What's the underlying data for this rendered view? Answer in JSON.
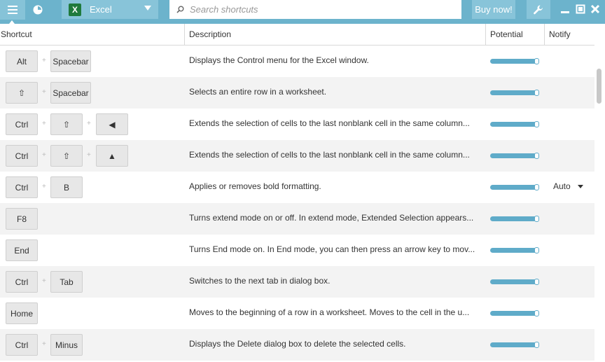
{
  "topbar": {
    "menu_icon": "hamburger-icon",
    "history_icon": "clock-icon",
    "app_selector": {
      "label": "Excel",
      "icon": "excel-icon"
    },
    "search": {
      "placeholder": "Search shortcuts",
      "value": ""
    },
    "buy_label": "Buy now!",
    "tools_icon": "wrench-icon",
    "window_controls": [
      "minimize-icon",
      "maximize-icon",
      "close-icon"
    ]
  },
  "table": {
    "columns": [
      "Shortcut",
      "Description",
      "Potential",
      "Notify"
    ],
    "rows": [
      {
        "keys": [
          "Alt",
          "Spacebar"
        ],
        "description": "Displays the Control menu for the Excel window.",
        "notify": ""
      },
      {
        "keys": [
          "⇧",
          "Spacebar"
        ],
        "description": "Selects an entire row in a worksheet.",
        "notify": ""
      },
      {
        "keys": [
          "Ctrl",
          "⇧",
          "◀"
        ],
        "description": "Extends the selection of cells to the last nonblank cell in the same column...",
        "notify": ""
      },
      {
        "keys": [
          "Ctrl",
          "⇧",
          "▲"
        ],
        "description": "Extends the selection of cells to the last nonblank cell in the same column...",
        "notify": ""
      },
      {
        "keys": [
          "Ctrl",
          "B"
        ],
        "description": "Applies or removes bold formatting.",
        "notify": "Auto"
      },
      {
        "keys": [
          "F8"
        ],
        "description": "Turns extend mode on or off. In extend mode, Extended Selection appears...",
        "notify": ""
      },
      {
        "keys": [
          "End"
        ],
        "description": "Turns End mode on. In End mode, you can then press an arrow key to mov...",
        "notify": ""
      },
      {
        "keys": [
          "Ctrl",
          "Tab"
        ],
        "description": "Switches to the next tab in dialog box.",
        "notify": ""
      },
      {
        "keys": [
          "Home"
        ],
        "description": "Moves to the beginning of a row in a worksheet. Moves to the cell in the u...",
        "notify": ""
      },
      {
        "keys": [
          "Ctrl",
          "Minus"
        ],
        "description": "Displays the Delete dialog box to delete the selected cells.",
        "notify": ""
      }
    ]
  },
  "colors": {
    "accent": "#6cb3cc",
    "bar": "#5fabc9",
    "row_alt": "#f3f3f3"
  }
}
